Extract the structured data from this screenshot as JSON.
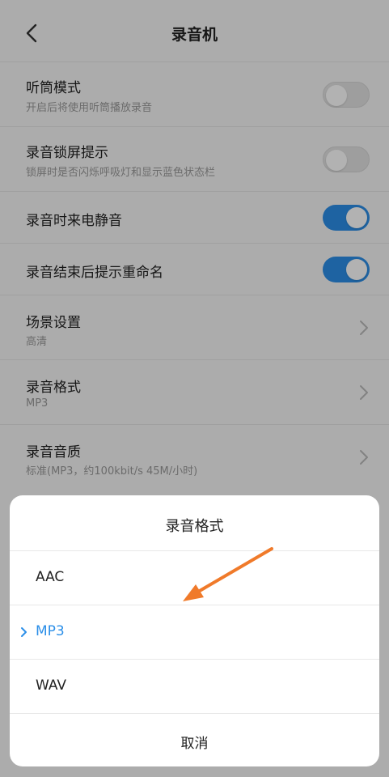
{
  "header": {
    "title": "录音机",
    "back_icon": "chevron-left-icon"
  },
  "settings": [
    {
      "title": "听筒模式",
      "subtitle": "开启后将使用听筒播放录音",
      "control": "toggle",
      "on": false
    },
    {
      "title": "录音锁屏提示",
      "subtitle": "锁屏时是否闪烁呼吸灯和显示蓝色状态栏",
      "control": "toggle",
      "on": false
    },
    {
      "title": "录音时来电静音",
      "subtitle": "",
      "control": "toggle",
      "on": true
    },
    {
      "title": "录音结束后提示重命名",
      "subtitle": "",
      "control": "toggle",
      "on": true
    },
    {
      "title": "场景设置",
      "subtitle": "高清",
      "control": "chevron"
    },
    {
      "title": "录音格式",
      "subtitle": "MP3",
      "control": "chevron"
    },
    {
      "title": "录音音质",
      "subtitle": "标准(MP3，约100kbit/s 45M/小时)",
      "control": "chevron"
    }
  ],
  "dialog": {
    "title": "录音格式",
    "options": [
      {
        "label": "AAC",
        "selected": false
      },
      {
        "label": "MP3",
        "selected": true
      },
      {
        "label": "WAV",
        "selected": false
      }
    ],
    "cancel_label": "取消"
  },
  "colors": {
    "accent": "#2c8fe8",
    "annotation_arrow": "#f07a2a"
  }
}
